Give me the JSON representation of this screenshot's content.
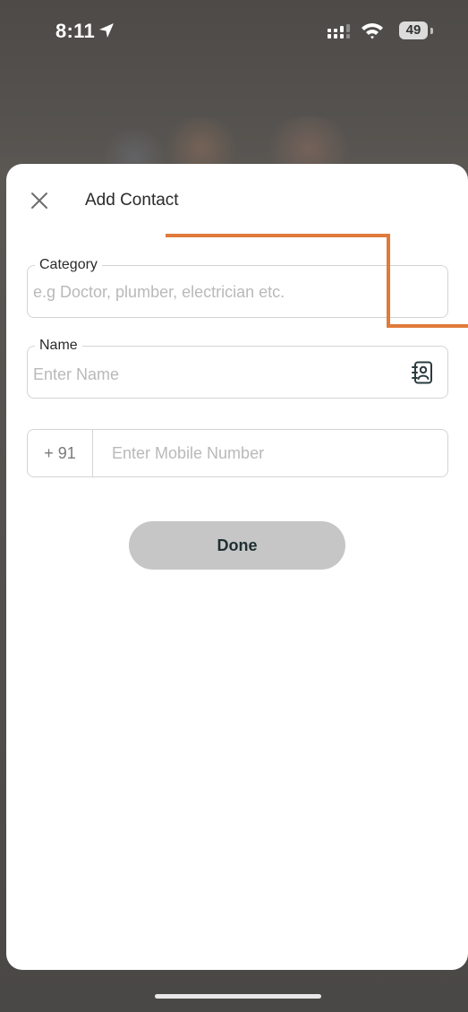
{
  "status_bar": {
    "time": "8:11",
    "battery": "49"
  },
  "sheet": {
    "title": "Add Contact",
    "close_icon": "close-icon"
  },
  "form": {
    "category": {
      "label": "Category",
      "placeholder": "e.g Doctor, plumber, electrician etc.",
      "value": ""
    },
    "name": {
      "label": "Name",
      "placeholder": "Enter Name",
      "value": "",
      "icon": "contacts-book-icon"
    },
    "phone": {
      "country_code": "+ 91",
      "placeholder": "Enter Mobile Number",
      "value": ""
    },
    "done_label": "Done"
  },
  "colors": {
    "annotation": "#e07a3a",
    "done_bg": "#c6c6c6",
    "done_text": "#1f2f32",
    "border": "#d4d4d4"
  }
}
